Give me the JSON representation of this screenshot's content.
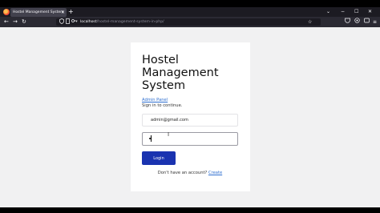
{
  "browser": {
    "tab_title": "Hostel Management System",
    "tab_close_glyph": "×",
    "new_tab_glyph": "+",
    "tab_list_glyph": "⌄",
    "window_controls": [
      "−",
      "☐",
      "✕"
    ],
    "url_host": "localhost",
    "url_path": "/hostel-management-system-in-php/",
    "nav": {
      "back": "←",
      "forward": "→",
      "reload": "↻"
    },
    "icons": [
      "shield-icon",
      "page-icon",
      "key-icon",
      "star-icon",
      "pocket-icon",
      "extensions-icon",
      "menu-icon"
    ]
  },
  "login": {
    "title_lines": [
      "Hostel",
      "Management",
      "System"
    ],
    "admin_link": "Admin Panel",
    "subtitle": "Sign in to continue.",
    "email_value": "admin@gmail.com",
    "password_masked": "•",
    "login_button": "Login",
    "signup_prompt": "Don't have an account?",
    "signup_link": "Create"
  },
  "colors": {
    "accent": "#1a33b0",
    "link": "#2f6fd0",
    "page_bg": "#f1f1f2",
    "browser_chrome": "#2b2a33"
  }
}
